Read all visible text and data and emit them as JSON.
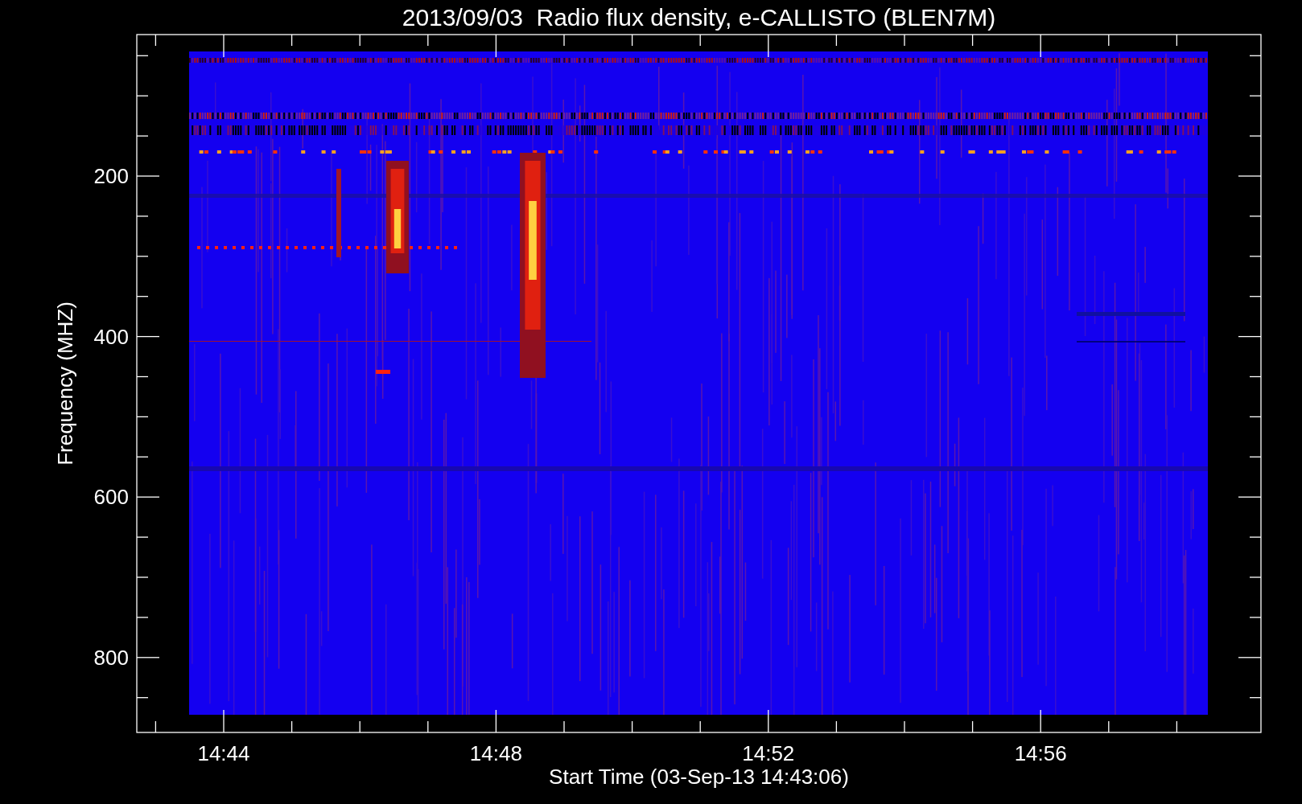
{
  "plot": {
    "title": "2013/09/03  Radio flux density, e-CALLISTO (BLEN7M)",
    "ylabel": "Frequency (MHZ)",
    "xlabel": "Start Time (03-Sep-13 14:43:06)",
    "yticks": [
      "200",
      "400",
      "600",
      "800"
    ],
    "xticks": [
      "14:44",
      "14:48",
      "14:52",
      "14:56"
    ]
  }
}
